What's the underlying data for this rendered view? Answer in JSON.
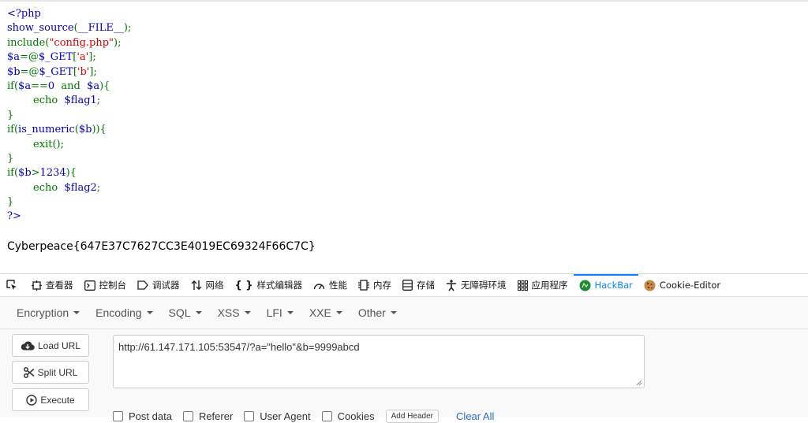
{
  "source_code": {
    "lines": [
      [
        {
          "t": "<?php",
          "c": "def"
        }
      ],
      [
        {
          "t": "show_source",
          "c": "def"
        },
        {
          "t": "(",
          "c": "kw"
        },
        {
          "t": "__FILE__",
          "c": "def"
        },
        {
          "t": ");",
          "c": "kw"
        }
      ],
      [
        {
          "t": "include(",
          "c": "kw"
        },
        {
          "t": "\"config.php\"",
          "c": "str"
        },
        {
          "t": ");",
          "c": "kw"
        }
      ],
      [
        {
          "t": "$a",
          "c": "def"
        },
        {
          "t": "=@",
          "c": "kw"
        },
        {
          "t": "$_GET",
          "c": "def"
        },
        {
          "t": "[",
          "c": "kw"
        },
        {
          "t": "'a'",
          "c": "str"
        },
        {
          "t": "];",
          "c": "kw"
        }
      ],
      [
        {
          "t": "$b",
          "c": "def"
        },
        {
          "t": "=@",
          "c": "kw"
        },
        {
          "t": "$_GET",
          "c": "def"
        },
        {
          "t": "[",
          "c": "kw"
        },
        {
          "t": "'b'",
          "c": "str"
        },
        {
          "t": "];",
          "c": "kw"
        }
      ],
      [
        {
          "t": "if(",
          "c": "kw"
        },
        {
          "t": "$a",
          "c": "def"
        },
        {
          "t": "==",
          "c": "kw"
        },
        {
          "t": "0 ",
          "c": "def"
        },
        {
          "t": " and ",
          "c": "kw"
        },
        {
          "t": " $a",
          "c": "def"
        },
        {
          "t": "){",
          "c": "kw"
        }
      ],
      [
        {
          "t": "        echo ",
          "c": "kw"
        },
        {
          "t": " $flag1",
          "c": "def"
        },
        {
          "t": ";",
          "c": "kw"
        }
      ],
      [
        {
          "t": "}",
          "c": "kw"
        }
      ],
      [
        {
          "t": "if(",
          "c": "kw"
        },
        {
          "t": "is_numeric",
          "c": "def"
        },
        {
          "t": "(",
          "c": "kw"
        },
        {
          "t": "$b",
          "c": "def"
        },
        {
          "t": ")){",
          "c": "kw"
        }
      ],
      [
        {
          "t": "        exit",
          "c": "kw"
        },
        {
          "t": "();",
          "c": "kw"
        }
      ],
      [
        {
          "t": "}",
          "c": "kw"
        }
      ],
      [
        {
          "t": "if(",
          "c": "kw"
        },
        {
          "t": "$b",
          "c": "def"
        },
        {
          "t": ">",
          "c": "kw"
        },
        {
          "t": "1234",
          "c": "def"
        },
        {
          "t": "){",
          "c": "kw"
        }
      ],
      [
        {
          "t": "        echo ",
          "c": "kw"
        },
        {
          "t": " $flag2",
          "c": "def"
        },
        {
          "t": ";",
          "c": "kw"
        }
      ],
      [
        {
          "t": "}",
          "c": "kw"
        }
      ],
      [
        {
          "t": "?>",
          "c": "def"
        }
      ]
    ]
  },
  "flag_output": "Cyberpeace{647E37C7627CC3E4019EC69324F66C7C}",
  "devtools_tabs": [
    {
      "label": "查看器",
      "icon": "inspector-icon"
    },
    {
      "label": "控制台",
      "icon": "console-icon"
    },
    {
      "label": "调试器",
      "icon": "debugger-icon"
    },
    {
      "label": "网络",
      "icon": "network-icon"
    },
    {
      "label": "样式编辑器",
      "icon": "style-editor-icon"
    },
    {
      "label": "性能",
      "icon": "performance-icon"
    },
    {
      "label": "内存",
      "icon": "memory-icon"
    },
    {
      "label": "存储",
      "icon": "storage-icon"
    },
    {
      "label": "无障碍环境",
      "icon": "accessibility-icon"
    },
    {
      "label": "应用程序",
      "icon": "application-icon"
    },
    {
      "label": "HackBar",
      "icon": "hackbar-icon",
      "active": true
    },
    {
      "label": "Cookie-Editor",
      "icon": "cookie-icon"
    }
  ],
  "hackbar": {
    "menu": [
      "Encryption",
      "Encoding",
      "SQL",
      "XSS",
      "LFI",
      "XXE",
      "Other"
    ],
    "buttons": {
      "load_url": "Load URL",
      "split_url": "Split URL",
      "execute": "Execute"
    },
    "url_value": "http://61.147.171.105:53547/?a=\"hello\"&b=9999abcd",
    "options": [
      "Post data",
      "Referer",
      "User Agent",
      "Cookies"
    ],
    "add_header": "Add Header",
    "clear_all": "Clear All"
  },
  "colors": {
    "accent": "#0a84ff",
    "php_default": "#0000bb",
    "php_keyword": "#007700",
    "php_string": "#dd0000"
  }
}
